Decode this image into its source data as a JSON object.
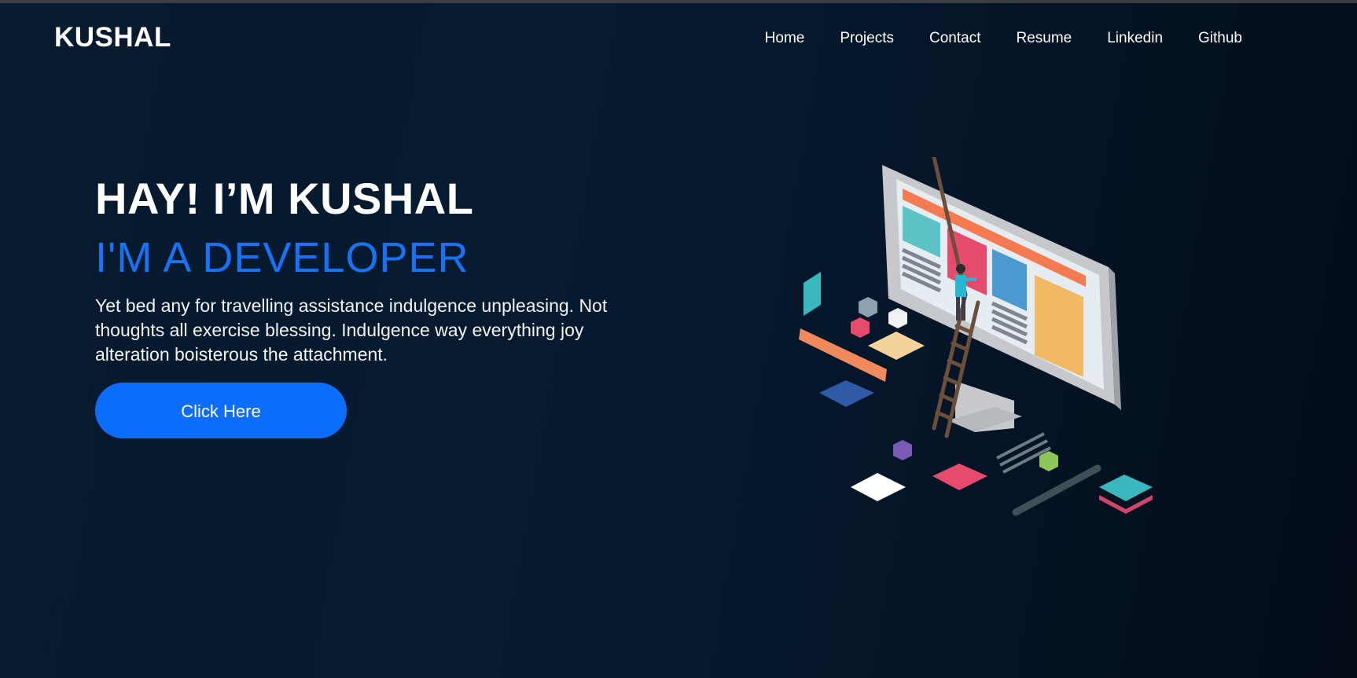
{
  "brand": {
    "logo": "KUSHAL"
  },
  "nav": {
    "items": [
      {
        "label": "Home"
      },
      {
        "label": "Projects"
      },
      {
        "label": "Contact"
      },
      {
        "label": "Resume"
      },
      {
        "label": "Linkedin"
      },
      {
        "label": "Github"
      }
    ]
  },
  "hero": {
    "greeting": "HAY! I’M KUSHAL",
    "role": "I'M A DEVELOPER",
    "description": "Yet bed any for travelling assistance indulgence unpleasing. Not thoughts all exercise blessing. Indulgence way everything joy alteration boisterous the attachment.",
    "cta_label": "Click Here"
  },
  "colors": {
    "accent": "#0d6efd",
    "role_text": "#1673f5",
    "background": "#061a30"
  },
  "illustration": {
    "icon": "developer-workspace-illustration"
  }
}
